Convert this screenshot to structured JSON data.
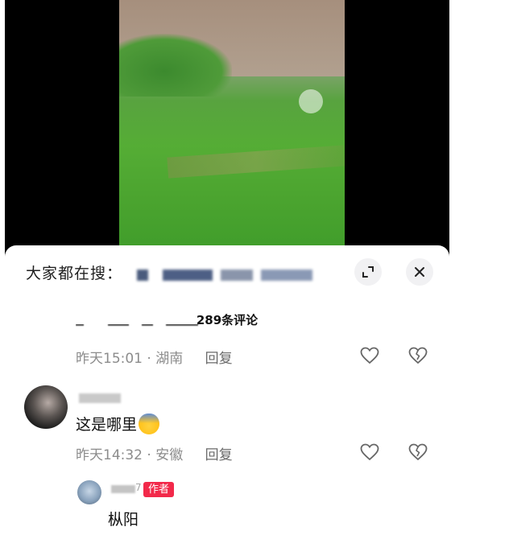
{
  "search": {
    "label": "大家都在搜："
  },
  "header": {
    "comment_count": "289条评论"
  },
  "comments": [
    {
      "time_location": "昨天15:01 · 湖南",
      "reply_label": "回复"
    },
    {
      "text": "这是哪里",
      "emoji": "scared-face-emoji",
      "time_location": "昨天14:32 · 安徽",
      "reply_label": "回复",
      "replies": [
        {
          "name_suffix": "7",
          "badge": "作者",
          "text": "枞阳"
        }
      ]
    }
  ],
  "icons": {
    "expand": "expand-icon",
    "close": "close-icon",
    "like": "heart-icon",
    "dislike": "broken-heart-icon"
  },
  "colors": {
    "author_badge": "#f2294a",
    "meta_text": "#8c8c8c",
    "sheet_bg": "#ffffff"
  }
}
